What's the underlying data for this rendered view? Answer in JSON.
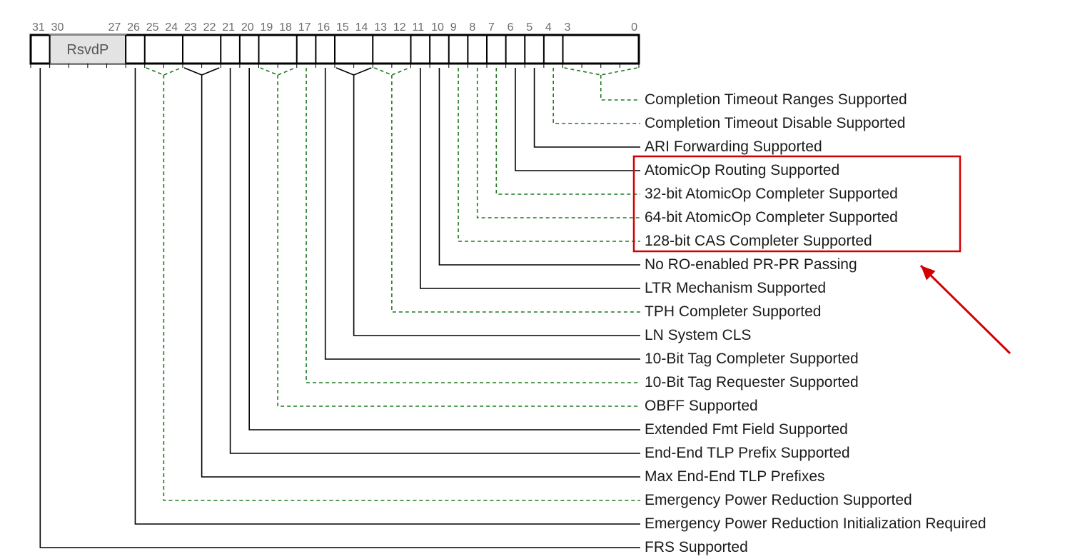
{
  "register": {
    "width": 32,
    "rsvd_label": "RsvdP",
    "rsvd_hi": 30,
    "rsvd_lo": 27,
    "bit_labels": [
      31,
      30,
      27,
      26,
      25,
      24,
      23,
      22,
      21,
      20,
      19,
      18,
      17,
      16,
      15,
      14,
      13,
      12,
      11,
      10,
      9,
      8,
      7,
      6,
      5,
      4,
      3,
      0
    ]
  },
  "fields": [
    {
      "hi": 3,
      "lo": 0,
      "label": "Completion Timeout Ranges Supported",
      "style": "green"
    },
    {
      "hi": 4,
      "lo": 4,
      "label": "Completion Timeout Disable Supported",
      "style": "green"
    },
    {
      "hi": 5,
      "lo": 5,
      "label": "ARI Forwarding Supported",
      "style": "black"
    },
    {
      "hi": 6,
      "lo": 6,
      "label": "AtomicOp Routing Supported",
      "style": "black",
      "boxed": true
    },
    {
      "hi": 7,
      "lo": 7,
      "label": "32-bit AtomicOp Completer Supported",
      "style": "green",
      "boxed": true
    },
    {
      "hi": 8,
      "lo": 8,
      "label": "64-bit AtomicOp Completer Supported",
      "style": "green",
      "boxed": true
    },
    {
      "hi": 9,
      "lo": 9,
      "label": "128-bit CAS Completer Supported",
      "style": "green",
      "boxed": true
    },
    {
      "hi": 10,
      "lo": 10,
      "label": "No RO-enabled PR-PR Passing",
      "style": "black"
    },
    {
      "hi": 11,
      "lo": 11,
      "label": "LTR Mechanism Supported",
      "style": "black"
    },
    {
      "hi": 13,
      "lo": 12,
      "label": "TPH Completer Supported",
      "style": "green"
    },
    {
      "hi": 15,
      "lo": 14,
      "label": "LN System CLS",
      "style": "black"
    },
    {
      "hi": 16,
      "lo": 16,
      "label": "10-Bit Tag Completer Supported",
      "style": "black"
    },
    {
      "hi": 17,
      "lo": 17,
      "label": "10-Bit Tag Requester Supported",
      "style": "green"
    },
    {
      "hi": 19,
      "lo": 18,
      "label": "OBFF Supported",
      "style": "green"
    },
    {
      "hi": 20,
      "lo": 20,
      "label": "Extended Fmt Field Supported",
      "style": "black"
    },
    {
      "hi": 21,
      "lo": 21,
      "label": "End-End TLP Prefix Supported",
      "style": "black"
    },
    {
      "hi": 23,
      "lo": 22,
      "label": "Max End-End TLP Prefixes",
      "style": "black"
    },
    {
      "hi": 25,
      "lo": 24,
      "label": "Emergency Power Reduction Supported",
      "style": "green"
    },
    {
      "hi": 26,
      "lo": 26,
      "label": "Emergency Power Reduction Initialization Required",
      "style": "black"
    },
    {
      "hi": 31,
      "lo": 31,
      "label": "FRS Supported",
      "style": "black"
    }
  ],
  "highlight": {
    "enabled": true,
    "color": "#d40000"
  }
}
